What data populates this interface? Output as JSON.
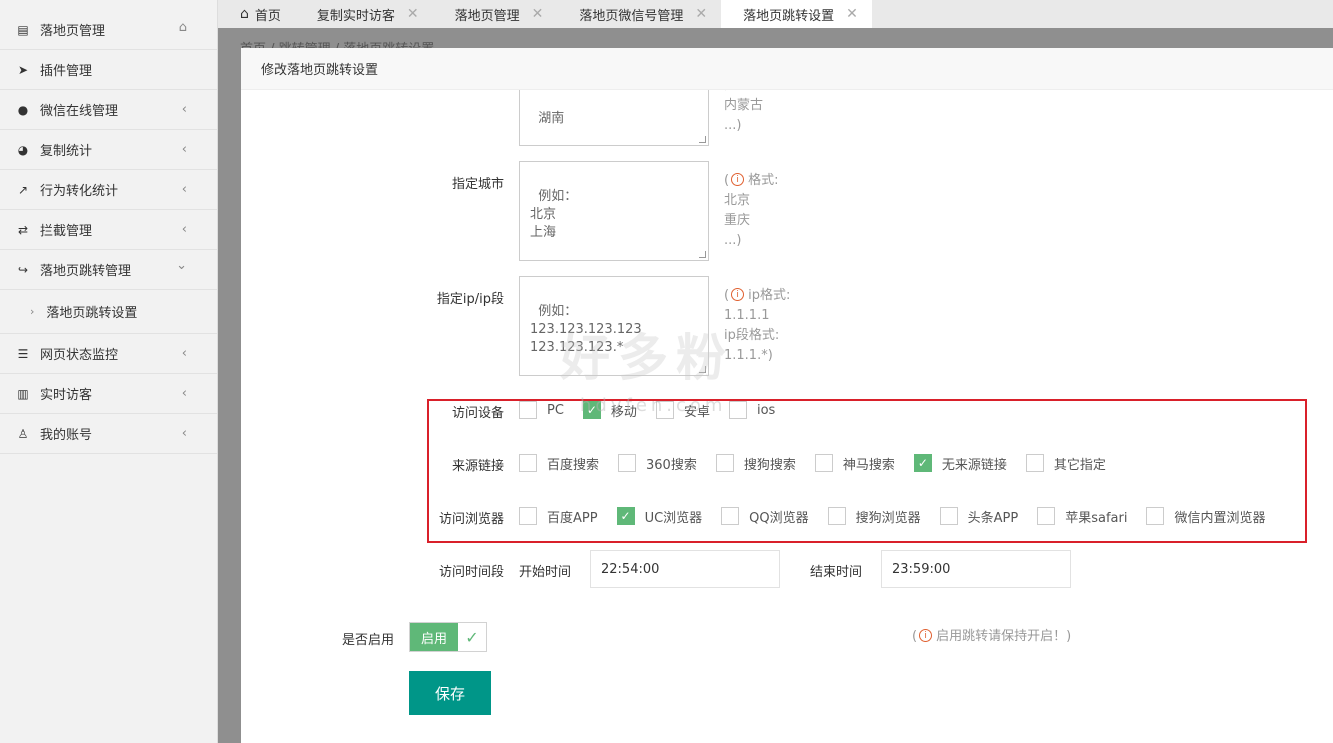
{
  "sidebar": {
    "items": [
      {
        "label": "落地页管理",
        "icon": "file-chart-icon",
        "extra": "home-icon"
      },
      {
        "label": "插件管理",
        "icon": "paper-plane-icon"
      },
      {
        "label": "微信在线管理",
        "icon": "wechat-icon",
        "chevron": "‹"
      },
      {
        "label": "复制统计",
        "icon": "pie-chart-icon",
        "chevron": "‹"
      },
      {
        "label": "行为转化统计",
        "icon": "line-chart-icon",
        "chevron": "‹"
      },
      {
        "label": "拦截管理",
        "icon": "exchange-icon",
        "chevron": "‹"
      },
      {
        "label": "落地页跳转管理",
        "icon": "share-icon",
        "chevron": "⌄"
      },
      {
        "label": "网页状态监控",
        "icon": "list-icon",
        "chevron": "‹"
      },
      {
        "label": "实时访客",
        "icon": "bar-chart-icon",
        "chevron": "‹"
      },
      {
        "label": "我的账号",
        "icon": "user-icon",
        "chevron": "‹"
      }
    ],
    "sub_item": "落地页跳转设置"
  },
  "tabs": [
    {
      "label": "首页",
      "closable": false
    },
    {
      "label": "复制实时访客",
      "closable": true
    },
    {
      "label": "落地页管理",
      "closable": true
    },
    {
      "label": "落地页微信号管理",
      "closable": true
    },
    {
      "label": "落地页跳转设置",
      "closable": true,
      "active": true
    }
  ],
  "breadcrumb": "首页 / 跳转管理 / 落地页跳转设置",
  "modal": {
    "title": "修改落地页跳转设置",
    "province": {
      "textarea_tail": "湖南",
      "hint_tail": "广东\n内蒙古\n...)"
    },
    "city": {
      "label": "指定城市",
      "placeholder": "例如：\n北京\n上海",
      "hint": "格式:\n北京\n重庆\n...)"
    },
    "ip": {
      "label": "指定ip/ip段",
      "placeholder": "例如：\n123.123.123.123\n123.123.123.*",
      "hint_line1": "ip格式:",
      "hint_rest": "1.1.1.1\nip段格式:\n1.1.1.*)"
    },
    "device": {
      "label": "访问设备",
      "options": [
        {
          "label": "PC",
          "checked": false
        },
        {
          "label": "移动",
          "checked": true
        },
        {
          "label": "安卓",
          "checked": false
        },
        {
          "label": "ios",
          "checked": false
        }
      ]
    },
    "referrer": {
      "label": "来源链接",
      "options": [
        {
          "label": "百度搜索",
          "checked": false
        },
        {
          "label": "360搜索",
          "checked": false
        },
        {
          "label": "搜狗搜索",
          "checked": false
        },
        {
          "label": "神马搜索",
          "checked": false
        },
        {
          "label": "无来源链接",
          "checked": true
        },
        {
          "label": "其它指定",
          "checked": false
        }
      ]
    },
    "browser": {
      "label": "访问浏览器",
      "options": [
        {
          "label": "百度APP",
          "checked": false
        },
        {
          "label": "UC浏览器",
          "checked": true
        },
        {
          "label": "QQ浏览器",
          "checked": false
        },
        {
          "label": "搜狗浏览器",
          "checked": false
        },
        {
          "label": "头条APP",
          "checked": false
        },
        {
          "label": "苹果safari",
          "checked": false
        },
        {
          "label": "微信内置浏览器",
          "checked": false
        }
      ]
    },
    "time": {
      "label": "访问时间段",
      "start_label": "开始时间",
      "start_value": "22:54:00",
      "end_label": "结束时间",
      "end_value": "23:59:00"
    },
    "enable": {
      "label": "是否启用",
      "switch_text": "启用",
      "on": true,
      "hint": "启用跳转请保持开启！",
      "hint_open": "(",
      "hint_close": ")"
    },
    "save_label": "保存"
  },
  "watermark": {
    "main": "好多粉",
    "sub": "hdyfen.com"
  },
  "colors": {
    "accent": "#009688",
    "success": "#5fb878",
    "highlight_border": "#d9202a"
  }
}
